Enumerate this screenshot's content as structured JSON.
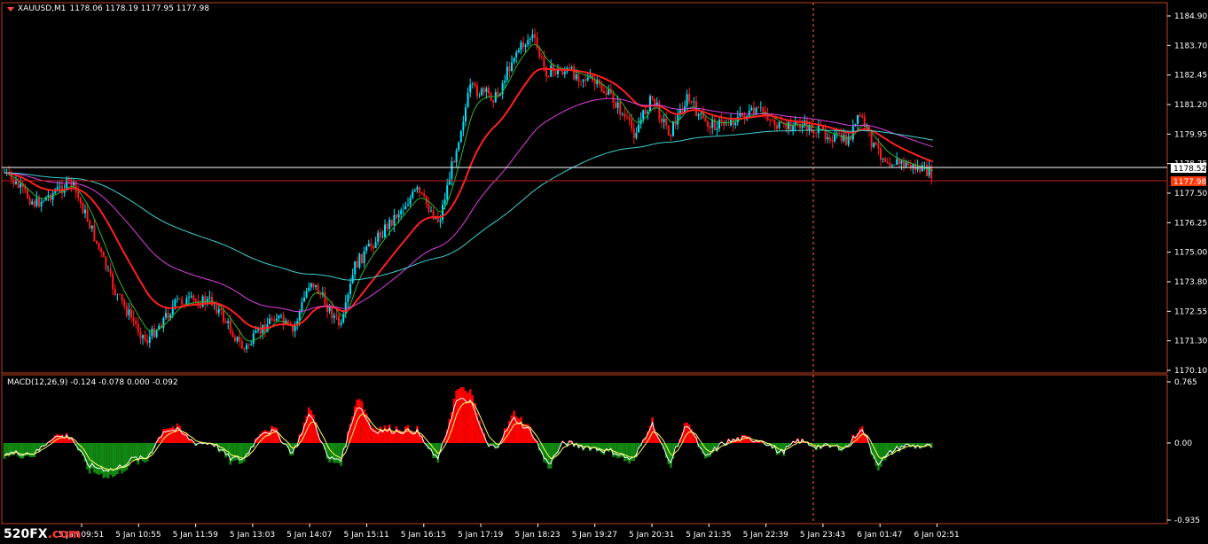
{
  "header": {
    "symbol_label": "XAUUSD,M1",
    "ohlc": "1178.06 1178.19 1177.95 1177.98"
  },
  "macd_header": "MACD(12,26,9) -0.124 -0.078 0.000 -0.092",
  "price_axis": [
    "1184.90",
    "1183.70",
    "1182.45",
    "1181.20",
    "1179.95",
    "1178.75",
    "1177.50",
    "1176.25",
    "1175.00",
    "1173.80",
    "1172.55",
    "1171.30",
    "1170.10"
  ],
  "current_prices": {
    "bid": "1178.52",
    "last": "1177.98"
  },
  "macd_axis": [
    "0.765",
    "0.00",
    "-0.935"
  ],
  "time_axis": [
    "5 Jan 09:51",
    "5 Jan 10:55",
    "5 Jan 11:59",
    "5 Jan 13:03",
    "5 Jan 14:07",
    "5 Jan 15:11",
    "5 Jan 16:15",
    "5 Jan 17:19",
    "5 Jan 18:23",
    "5 Jan 19:27",
    "5 Jan 20:31",
    "5 Jan 21:35",
    "5 Jan 22:39",
    "5 Jan 23:43",
    "6 Jan 01:47",
    "6 Jan 02:51"
  ],
  "logo": {
    "brand": "520FX",
    "domain": ".com"
  },
  "colors": {
    "background": "#000000",
    "bull_candle": "#00e5ff",
    "bear_candle": "#ff1a1a",
    "ma_red": "#ff2020",
    "ma_magenta": "#e040e0",
    "ma_cyan": "#40d0d0",
    "ma_green": "#2fb52f",
    "macd_pos": "#ff0000",
    "macd_neg": "#118811",
    "macd_line": "#ffffff",
    "signal_line": "#ffff66",
    "crosshair": "#ff6a1a"
  }
}
